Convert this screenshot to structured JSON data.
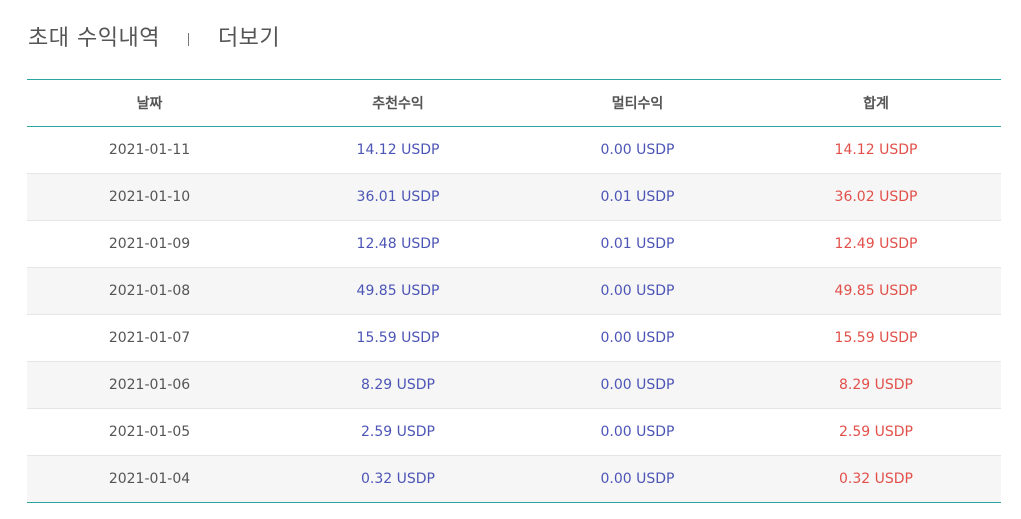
{
  "header": {
    "title": "초대 수익내역",
    "more_label": "더보기"
  },
  "table": {
    "columns": [
      "날짜",
      "추천수익",
      "멀티수익",
      "합계"
    ],
    "rows": [
      {
        "date": "2021-01-11",
        "referral": "14.12 USDP",
        "multi": "0.00 USDP",
        "total": "14.12 USDP"
      },
      {
        "date": "2021-01-10",
        "referral": "36.01 USDP",
        "multi": "0.01 USDP",
        "total": "36.02 USDP"
      },
      {
        "date": "2021-01-09",
        "referral": "12.48 USDP",
        "multi": "0.01 USDP",
        "total": "12.49 USDP"
      },
      {
        "date": "2021-01-08",
        "referral": "49.85 USDP",
        "multi": "0.00 USDP",
        "total": "49.85 USDP"
      },
      {
        "date": "2021-01-07",
        "referral": "15.59 USDP",
        "multi": "0.00 USDP",
        "total": "15.59 USDP"
      },
      {
        "date": "2021-01-06",
        "referral": "8.29 USDP",
        "multi": "0.00 USDP",
        "total": "8.29 USDP"
      },
      {
        "date": "2021-01-05",
        "referral": "2.59 USDP",
        "multi": "0.00 USDP",
        "total": "2.59 USDP"
      },
      {
        "date": "2021-01-04",
        "referral": "0.32 USDP",
        "multi": "0.00 USDP",
        "total": "0.32 USDP"
      }
    ]
  },
  "colors": {
    "accent_line": "#2aa6a2",
    "referral_text": "#4c55b6",
    "multi_text": "#4c55b6",
    "total_text": "#e2504a",
    "stripe": "#f6f6f6"
  }
}
